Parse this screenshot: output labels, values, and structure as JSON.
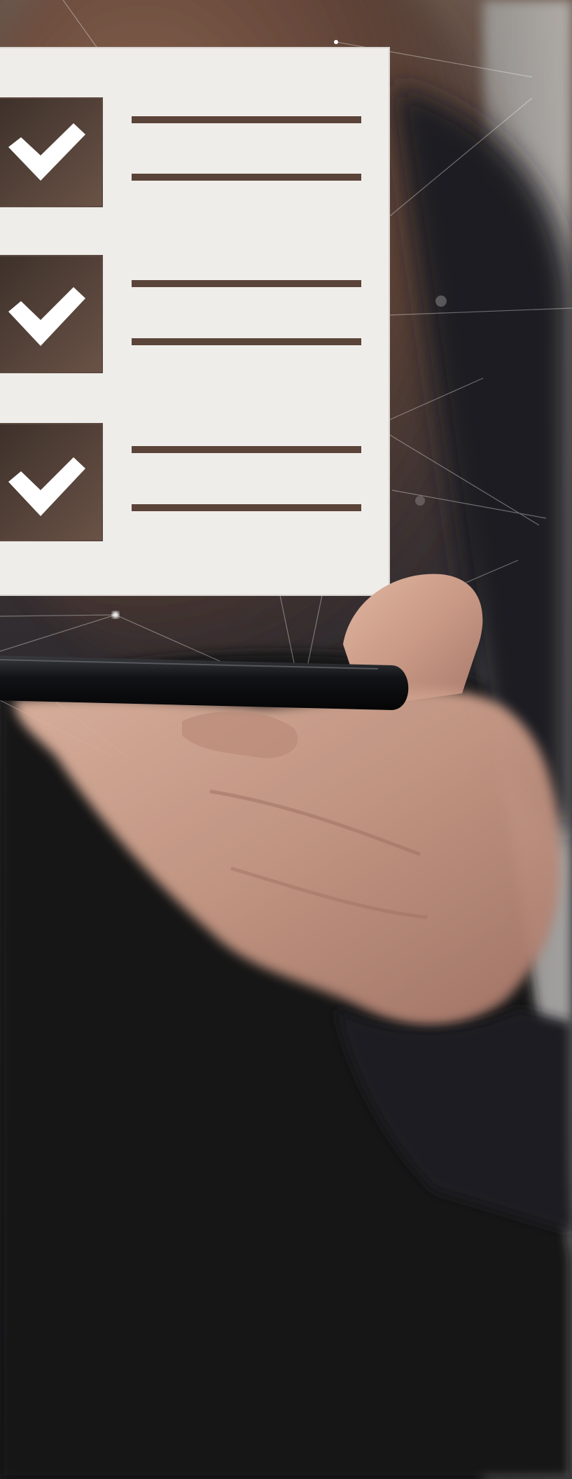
{
  "scene": {
    "colors": {
      "background_top": "#6f5a4f",
      "background_mid": "#2a2a30",
      "background_bottom": "#17181c",
      "wall_right": "#a9a8a6",
      "hair": "#6b4a3a",
      "panel": "#efedea",
      "checkbox": "#4a3b33",
      "checkmark": "#ffffff",
      "lines": "#5a4338",
      "phone": "#0f1012",
      "skin": "#c99b87",
      "network": "#ffffff"
    },
    "checklist": {
      "items": [
        {
          "checked": true,
          "line_count": 2
        },
        {
          "checked": true,
          "line_count": 2
        },
        {
          "checked": true,
          "line_count": 2
        }
      ]
    },
    "icons": {
      "check": "checkmark-icon",
      "device": "smartphone-icon",
      "network": "network-node-icon"
    }
  }
}
